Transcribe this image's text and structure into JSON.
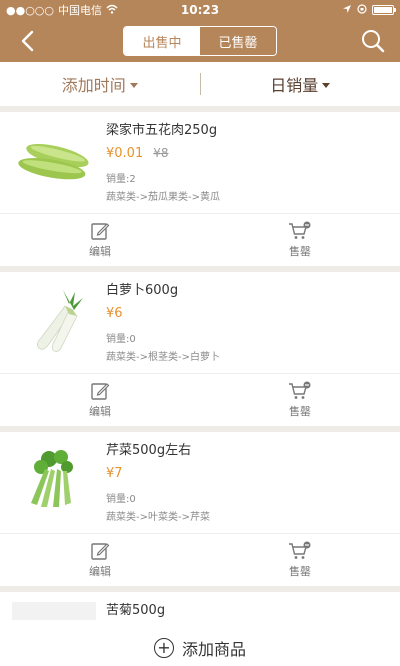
{
  "status_bar": {
    "signal": "●●○○○",
    "carrier": "中国电信",
    "time": "10:23"
  },
  "nav": {
    "tabs": [
      {
        "label": "出售中",
        "active": true
      },
      {
        "label": "已售罄",
        "active": false
      }
    ]
  },
  "filters": {
    "sort_time": "添加时间",
    "sort_sales": "日销量"
  },
  "products": [
    {
      "name": "梁家市五花肉250g",
      "price": "¥0.01",
      "original_price": "¥8",
      "sales": "销量:2",
      "category": "蔬菜类->茄瓜果类->黄瓜",
      "image": "cucumber"
    },
    {
      "name": "白萝卜600g",
      "price": "¥6",
      "original_price": "",
      "sales": "销量:0",
      "category": "蔬菜类->根茎类->白萝卜",
      "image": "radish"
    },
    {
      "name": "芹菜500g左右",
      "price": "¥7",
      "original_price": "",
      "sales": "销量:0",
      "category": "蔬菜类->叶菜类->芹菜",
      "image": "celery"
    },
    {
      "name": "苦菊500g",
      "price": "",
      "original_price": "",
      "sales": "",
      "category": "",
      "image": ""
    }
  ],
  "actions": {
    "edit": "编辑",
    "sold_out": "售罄"
  },
  "add_product": "添加商品",
  "colors": {
    "brand": "#b5865a",
    "price": "#e8922c"
  }
}
